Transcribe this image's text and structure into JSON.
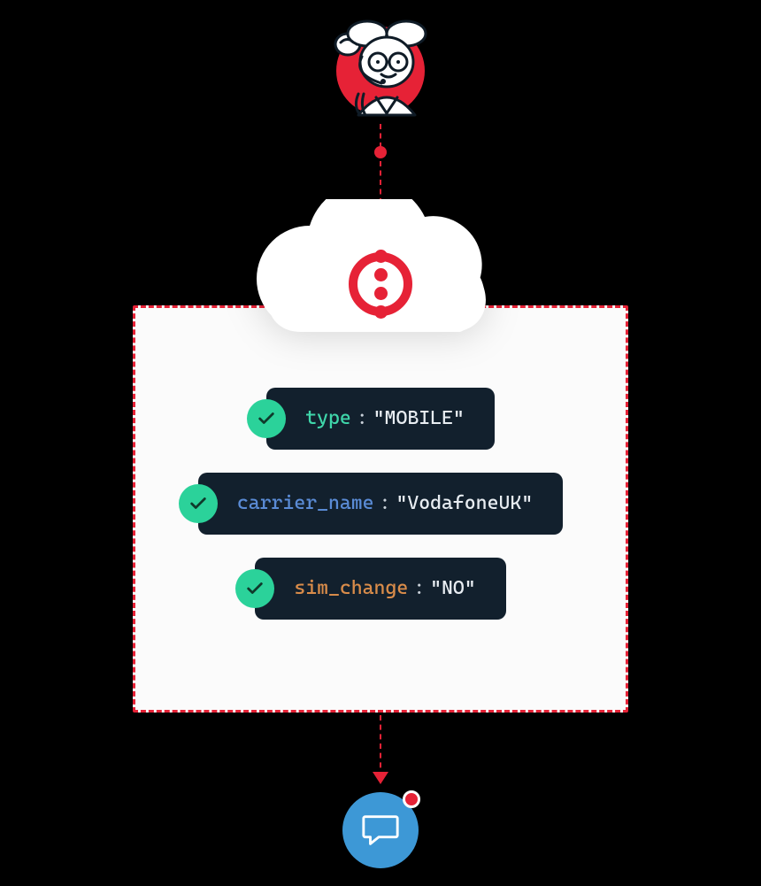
{
  "avatar": {
    "alt": "support-agent"
  },
  "logo": {
    "name": "twilio-logo"
  },
  "checks": [
    {
      "key": "type",
      "value": "\"MOBILE\"",
      "keyClass": "key-green"
    },
    {
      "key": "carrier_name",
      "value": "\"VodafoneUK\"",
      "keyClass": "key-blue"
    },
    {
      "key": "sim_change",
      "value": "\"NO\"",
      "keyClass": "key-orange"
    }
  ],
  "colors": {
    "brand": "#e62236",
    "code_bg": "#12202d",
    "check": "#2bd29a",
    "chat": "#3d98d6"
  }
}
